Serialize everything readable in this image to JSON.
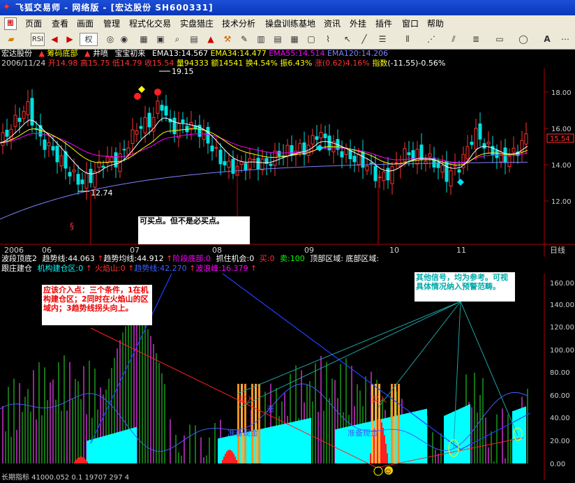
{
  "window": {
    "title": "飞狐交易师 - 网络版 - [宏达股份 SH600331]"
  },
  "menu": [
    "页面",
    "查看",
    "画面",
    "管理",
    "程式化交易",
    "实盘猎庄",
    "技术分析",
    "操盘训练基地",
    "资讯",
    "外挂",
    "插件",
    "窗口",
    "帮助"
  ],
  "toolbar": {
    "quan_label": "权",
    "rsi_label": "RSI",
    "text_tool": "A"
  },
  "main_panel": {
    "stock_name": "宏达股份",
    "indicator_name": "筹码底部",
    "jingpen": "井喷",
    "baobao": "宝宝初来",
    "ema13": "EMA13:14.567",
    "ema34": "EMA34:14.477",
    "ema55": "EMA55:14.514",
    "ema120": "EMA120:14.206",
    "date": "2006/11/24",
    "open": "开14.98",
    "high": "高15.75",
    "low": "低14.79",
    "close": "收15.54",
    "volume": "量94333",
    "amount": "额14541",
    "turnover": "换4.54%",
    "amplitude": "振6.43%",
    "change_label": "涨",
    "change": "(0.62)",
    "change_pct": "4.16%",
    "index": "指数",
    "index_change": "(-11.55)",
    "index_pct": "-0.56%",
    "high_mark": "19.15",
    "low_mark": "12.74",
    "current_price": "15.54",
    "y_ticks": [
      "18.00",
      "16.00",
      "14.00",
      "12.00"
    ]
  },
  "x_axis": {
    "labels": [
      "2006",
      "06",
      "07",
      "08",
      "09",
      "10",
      "11"
    ],
    "period": "日线"
  },
  "wave_line": {
    "name": "波段顶底2",
    "trend": "趋势线:44.063",
    "trend_avg": "趋势均线:44.912",
    "stage_bottom": "阶段底部:0",
    "catch": "抓住机会:0",
    "buy": "买:0",
    "sell": "卖:100",
    "top_zone": "顶部区域:",
    "bottom_zone": "底部区域:"
  },
  "follow_line": {
    "name": "跟庄建仓",
    "jc": "机构建仓区:0",
    "fire": "火焰山:0",
    "trend": "趋势线:42.270",
    "wave": "波浪峰:16.379"
  },
  "sub_axis": {
    "ticks": [
      "160.00",
      "140.00",
      "120.00",
      "100.00",
      "80.00",
      "60.00",
      "40.00",
      "20.00",
      "0.00"
    ]
  },
  "annotations": {
    "buy_point_note": "可买点。但不是必买点。",
    "condition_note": "应该介入点：三个条件，1在机构建仓区；2同时在火焰山的区域内；3趋势线拐头向上。",
    "other_signal_note": "其他信号，均为参考。可视具体情况纳入预警范畴。",
    "buy_in_1": "买入",
    "buy_in_2": "买入",
    "zhunbei_1": "准备现金",
    "zhunbei_2": "准备现金",
    "zhuzhang": "涨"
  },
  "bottom_partial": "长期指标 41000.052 0.1 19707 297 4",
  "colors": {
    "up": "#ff3232",
    "down": "#00e0e0",
    "ema13": "#ffffff",
    "ema34": "#ffff00",
    "ema55": "#ff00ff",
    "ema120": "#8080ff",
    "cyan_fill": "#00ffff"
  },
  "chart_data": [
    {
      "type": "candlestick",
      "title": "宏达股份 SH600331",
      "ylim": [
        11.0,
        19.6
      ],
      "series": [
        {
          "name": "EMA13",
          "values": [
            14.6
          ]
        },
        {
          "name": "EMA34",
          "values": [
            14.5
          ]
        },
        {
          "name": "EMA55",
          "values": [
            14.5
          ]
        },
        {
          "name": "EMA120",
          "values": [
            14.2
          ]
        }
      ],
      "annotations": [
        "19.15",
        "12.74",
        "15.54"
      ]
    },
    {
      "type": "bar",
      "title": "跟庄建仓",
      "ylim": [
        0,
        170
      ],
      "series": [
        {
          "name": "趋势线",
          "values": [
            42.27
          ]
        },
        {
          "name": "波浪峰",
          "values": [
            16.379
          ]
        }
      ]
    }
  ]
}
